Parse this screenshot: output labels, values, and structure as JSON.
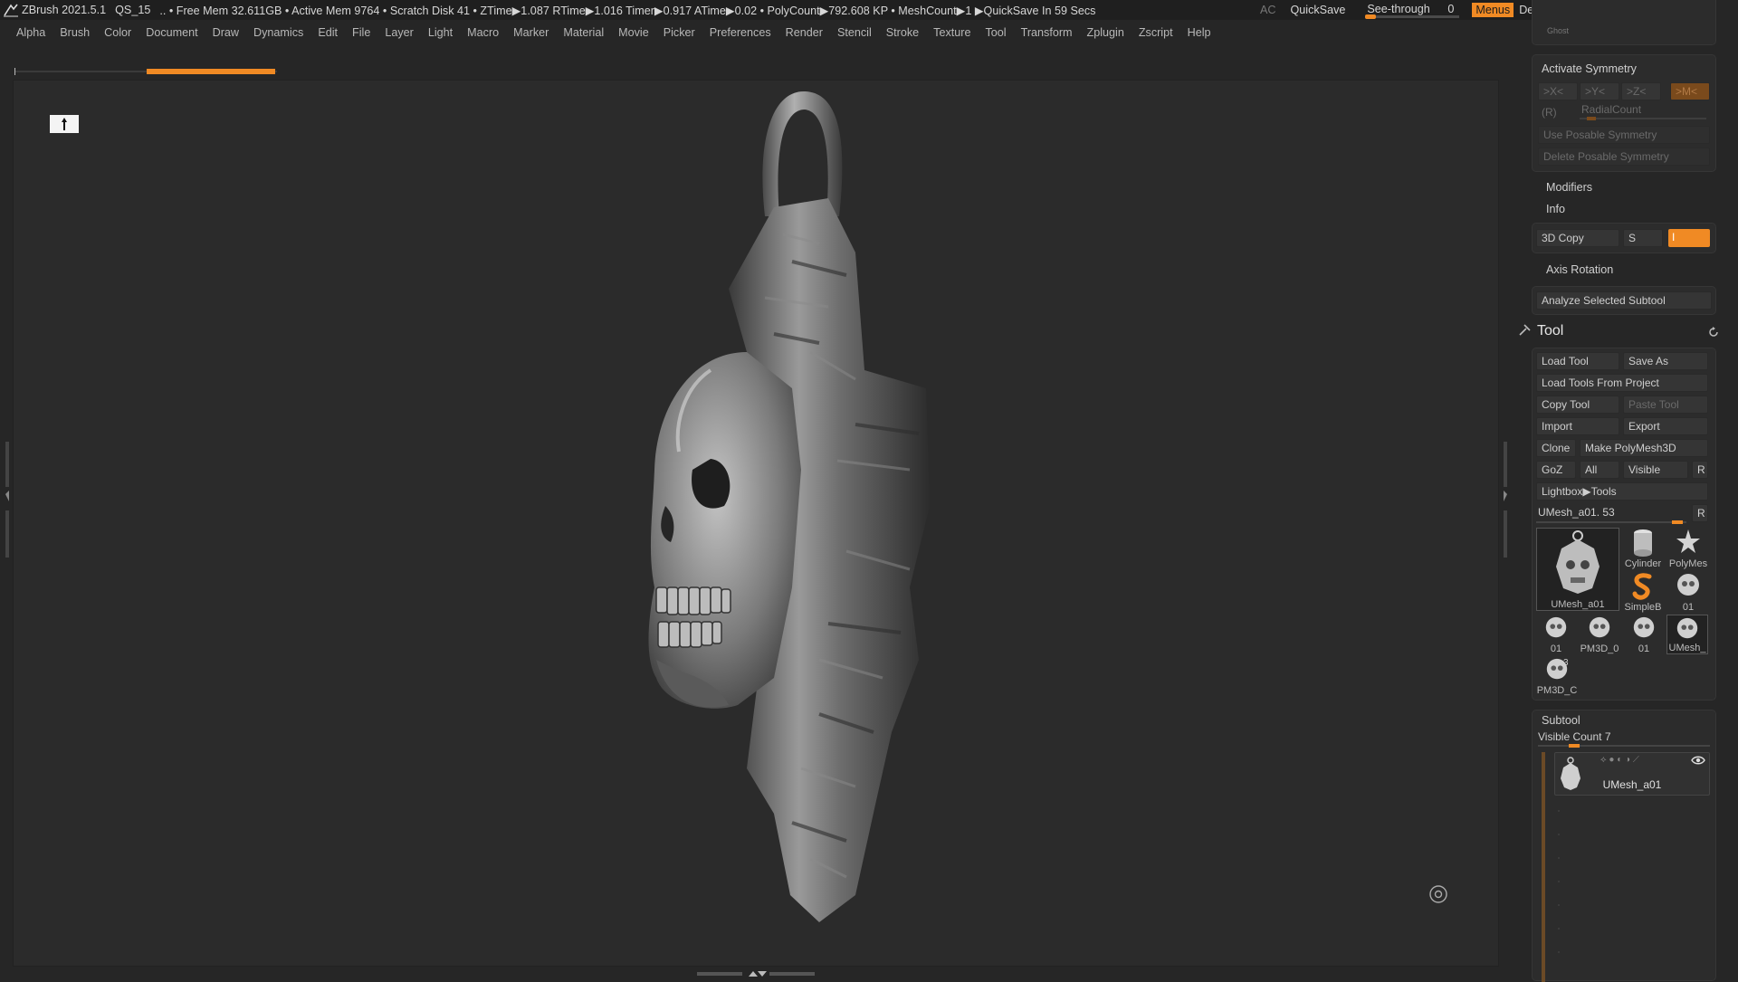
{
  "titlebar": {
    "app": "ZBrush 2021.5.1",
    "doc": "QS_15",
    "status": ".. • Free Mem 32.611GB • Active Mem 9764 • Scratch Disk 41 •  ZTime▶1.087 RTime▶1.016 Timer▶0.917 ATime▶0.02 • PolyCount▶792.608 KP  • MeshCount▶1  ▶QuickSave In 59 Secs",
    "ac": "AC",
    "quicksave": "QuickSave",
    "see_through_label": "See-through",
    "see_through_value": "0",
    "menus": "Menus",
    "script": "DefaultZScript",
    "accent": "#f08a24"
  },
  "menu": [
    "Alpha",
    "Brush",
    "Color",
    "Document",
    "Draw",
    "Dynamics",
    "Edit",
    "File",
    "Layer",
    "Light",
    "Macro",
    "Marker",
    "Material",
    "Movie",
    "Picker",
    "Preferences",
    "Render",
    "Stencil",
    "Stroke",
    "Texture",
    "Tool",
    "Transform",
    "Zplugin",
    "Zscript",
    "Help"
  ],
  "panel": {
    "ghost": "Ghost",
    "activate_symmetry": "Activate Symmetry",
    "sym_x": ">X<",
    "sym_y": ">Y<",
    "sym_z": ">Z<",
    "sym_m": ">M<",
    "sym_r": "(R)",
    "radial_count": "RadialCount",
    "use_posable": "Use Posable Symmetry",
    "delete_posable": "Delete Posable Symmetry",
    "modifiers": "Modifiers",
    "info": "Info",
    "copy3d": "3D Copy",
    "copy3d_s": "S",
    "copy3d_i": "I",
    "axis_rotation": "Axis Rotation",
    "analyze": "Analyze Selected Subtool",
    "tool_title": "Tool",
    "load_tool": "Load Tool",
    "save_as": "Save As",
    "load_from_project": "Load Tools From Project",
    "copy_tool": "Copy Tool",
    "paste_tool": "Paste Tool",
    "import": "Import",
    "export": "Export",
    "clone": "Clone",
    "make_polymesh": "Make PolyMesh3D",
    "goz": "GoZ",
    "all": "All",
    "visible": "Visible",
    "r": "R",
    "lightbox_tools": "Lightbox▶Tools",
    "current_tool": "UMesh_a01. 53",
    "current_tool_r": "R",
    "thumbs": {
      "main": "UMesh_a01",
      "cylinder": "Cylinder",
      "polymesh": "PolyMes",
      "simpleb": "SimpleB",
      "t01a": "01",
      "t01b": "01",
      "pm3d1": "PM3D_0",
      "t01c": "01",
      "umesh": "UMesh_",
      "pm3d2": "PM3D_C",
      "badge": "3"
    },
    "subtool_title": "Subtool",
    "visible_count": "Visible Count 7",
    "subtool_name": "UMesh_a01"
  }
}
